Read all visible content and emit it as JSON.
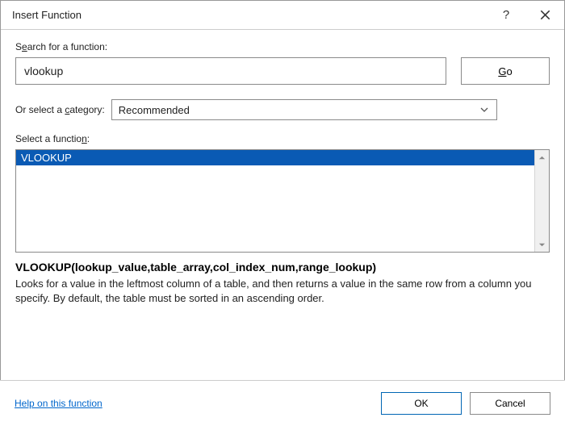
{
  "titlebar": {
    "title": "Insert Function"
  },
  "search": {
    "label_pre": "S",
    "label_u": "e",
    "label_post": "arch for a function:",
    "value": "vlookup",
    "go_u": "G",
    "go_post": "o"
  },
  "category": {
    "label_pre": "Or select a ",
    "label_u": "c",
    "label_post": "ategory:",
    "selected": "Recommended"
  },
  "selectfn": {
    "label_pre": "Select a functio",
    "label_u": "n",
    "label_post": ":"
  },
  "list": {
    "items": [
      "VLOOKUP"
    ]
  },
  "detail": {
    "signature": "VLOOKUP(lookup_value,table_array,col_index_num,range_lookup)",
    "description": "Looks for a value in the leftmost column of a table, and then returns a value in the same row from a column you specify. By default, the table must be sorted in an ascending order."
  },
  "footer": {
    "help_link": "Help on this function",
    "ok": "OK",
    "cancel": "Cancel"
  }
}
